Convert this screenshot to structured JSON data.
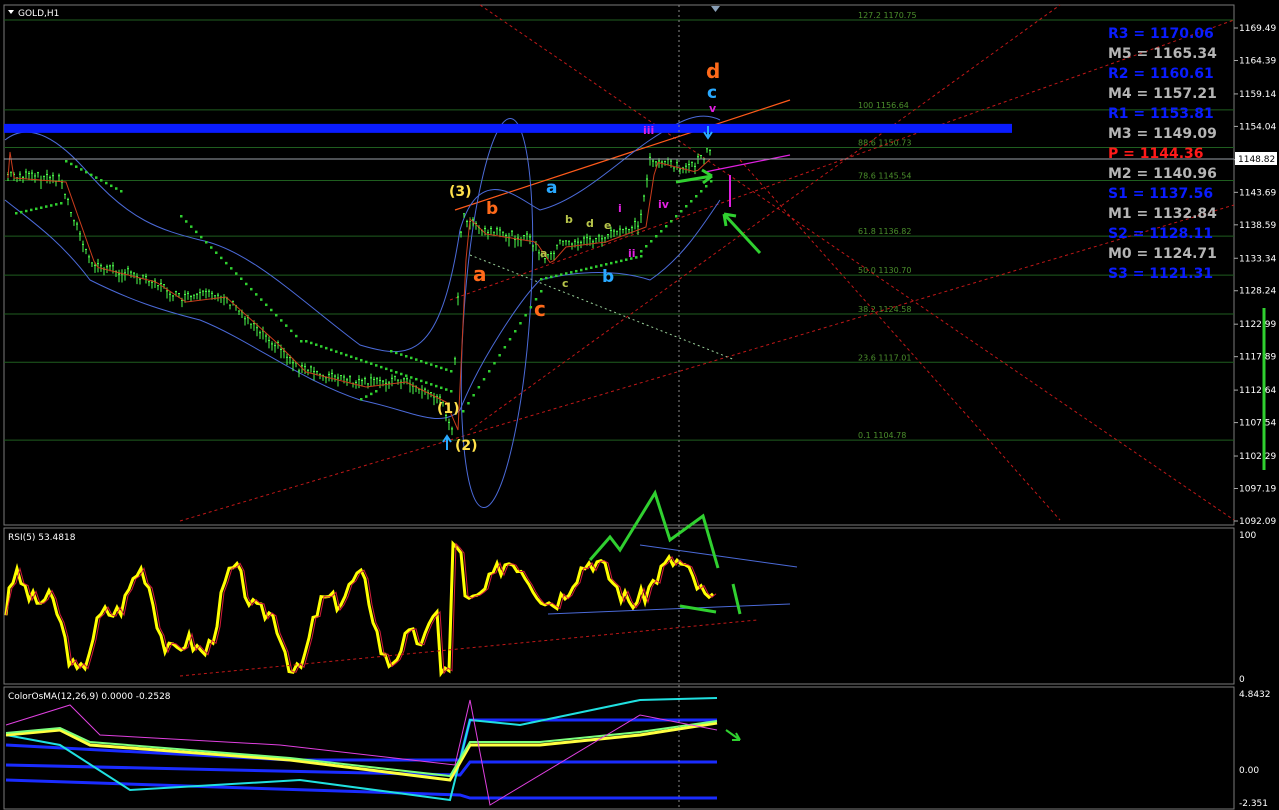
{
  "chart_data": {
    "type": "candlestick",
    "symbol_timeframe": "GOLD,H1",
    "price_axis": {
      "ticks": [
        "1169.49",
        "1164.39",
        "1159.14",
        "1154.04",
        "1148.82",
        "1143.69",
        "1138.59",
        "1133.34",
        "1128.24",
        "1122.99",
        "1117.89",
        "1112.64",
        "1107.54",
        "1102.29",
        "1097.19",
        "1092.09"
      ],
      "current_price": "1148.82",
      "range": [
        1090.5,
        1173.5
      ]
    },
    "fibonacci_levels": [
      {
        "label": "127.2 1170.75",
        "value": 1170.75
      },
      {
        "label": "100 1156.64",
        "value": 1156.64
      },
      {
        "label": "88.6 1150.73",
        "value": 1150.73
      },
      {
        "label": "78.6 1145.54",
        "value": 1145.54
      },
      {
        "label": "61.8 1136.82",
        "value": 1136.82
      },
      {
        "label": "50.0 1130.70",
        "value": 1130.7
      },
      {
        "label": "38.2 1124.58",
        "value": 1124.58
      },
      {
        "label": "23.6 1117.01",
        "value": 1117.01
      },
      {
        "label": "0.1 1104.78",
        "value": 1104.78
      }
    ],
    "pivots": [
      {
        "label": "R3 = 1170.06",
        "color": "#0a1cff"
      },
      {
        "label": "M5 = 1165.34",
        "color": "#b4b4b4"
      },
      {
        "label": "R2 = 1160.61",
        "color": "#0a1cff"
      },
      {
        "label": "M4 = 1157.21",
        "color": "#b4b4b4"
      },
      {
        "label": "R1 = 1153.81",
        "color": "#0a1cff"
      },
      {
        "label": "M3 = 1149.09",
        "color": "#b4b4b4"
      },
      {
        "label": "P  = 1144.36",
        "color": "#ff1a1a"
      },
      {
        "label": "M2 = 1140.96",
        "color": "#b4b4b4"
      },
      {
        "label": "S1 = 1137.56",
        "color": "#0a1cff"
      },
      {
        "label": "M1 = 1132.84",
        "color": "#b4b4b4"
      },
      {
        "label": "S2 = 1128.11",
        "color": "#0a1cff"
      },
      {
        "label": "M0 = 1124.71",
        "color": "#b4b4b4"
      },
      {
        "label": "S3 = 1121.31",
        "color": "#0a1cff"
      }
    ],
    "wave_labels": [
      {
        "text": "d",
        "color": "#ff6a1a"
      },
      {
        "text": "c",
        "color": "#29a9ff"
      },
      {
        "text": "v",
        "color": "#e020e0"
      },
      {
        "text": "iii",
        "color": "#e020e0"
      },
      {
        "text": "(3)",
        "color": "#ffe14a"
      },
      {
        "text": "b",
        "color": "#ff6a1a"
      },
      {
        "text": "a",
        "color": "#29a9ff"
      },
      {
        "text": "b",
        "color": "#b7c44a"
      },
      {
        "text": "d",
        "color": "#b7c44a"
      },
      {
        "text": "i",
        "color": "#e020e0"
      },
      {
        "text": "iv",
        "color": "#e020e0"
      },
      {
        "text": "e",
        "color": "#b7c44a"
      },
      {
        "text": "ii",
        "color": "#e020e0"
      },
      {
        "text": "a",
        "color": "#ff6a1a"
      },
      {
        "text": "c",
        "color": "#b7c44a"
      },
      {
        "text": "b",
        "color": "#29a9ff"
      },
      {
        "text": "a",
        "color": "#b7c44a"
      },
      {
        "text": "c",
        "color": "#ff6a1a"
      },
      {
        "text": "(1)",
        "color": "#ffe14a"
      },
      {
        "text": "(2)",
        "color": "#ffe14a"
      }
    ],
    "rsi": {
      "title": "RSI(5) 53.4818",
      "scale_top": "100",
      "scale_bottom": "0"
    },
    "osma": {
      "title": "ColorOsMA(12,26,9) 0.0000 -0.2528",
      "scale_top": "4.8432",
      "scale_mid": "0.00",
      "scale_bottom": "-2.351"
    }
  }
}
